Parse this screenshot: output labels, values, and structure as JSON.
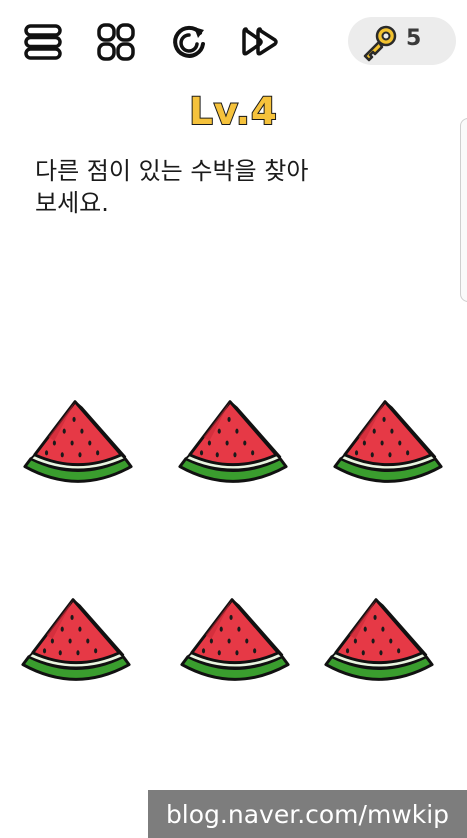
{
  "toolbar": {
    "menu_icon": "menu-stack-icon",
    "grid_icon": "grid-icon",
    "restart_icon": "restart-icon",
    "skip_icon": "fast-forward-icon",
    "key_icon": "key-icon",
    "key_count": "5"
  },
  "level": {
    "label": "Lv.4"
  },
  "question": {
    "line1": "다른 점이 있는 수박을 찾아",
    "line2": "보세요."
  },
  "melons": [
    {
      "name": "watermelon-1"
    },
    {
      "name": "watermelon-2"
    },
    {
      "name": "watermelon-3"
    },
    {
      "name": "watermelon-4"
    },
    {
      "name": "watermelon-5"
    },
    {
      "name": "watermelon-6"
    }
  ],
  "watermark": "blog.naver.com/mwkip",
  "colors": {
    "level_fill": "#f5c23c",
    "melon_flesh": "#e63946",
    "melon_rind": "#3a9d2e",
    "key": "#f2c230"
  }
}
